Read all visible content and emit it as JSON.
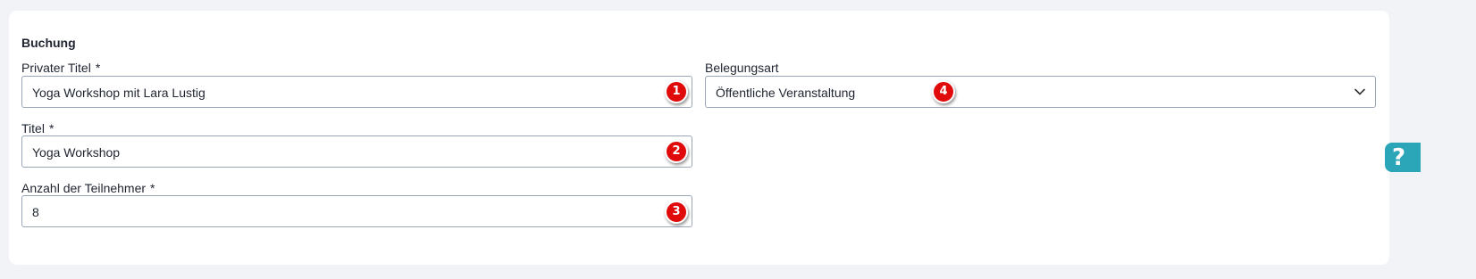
{
  "section": {
    "title": "Buchung"
  },
  "fields": {
    "private_title": {
      "label": "Privater Titel",
      "required": "*",
      "value": "Yoga Workshop mit Lara Lustig",
      "marker": "1"
    },
    "title": {
      "label": "Titel",
      "required": "*",
      "value": "Yoga Workshop",
      "marker": "2"
    },
    "participants": {
      "label": "Anzahl der Teilnehmer",
      "required": "*",
      "value": "8",
      "marker": "3"
    },
    "booking_type": {
      "label": "Belegungsart",
      "value": "Öffentliche Veranstaltung",
      "marker": "4"
    }
  },
  "help": {
    "icon": "question-icon",
    "glyph": "?"
  },
  "colors": {
    "marker": "#e00a0a",
    "border": "#9aa6b6",
    "help_tab": "#2aa6b8",
    "background": "#f1f3f7"
  }
}
